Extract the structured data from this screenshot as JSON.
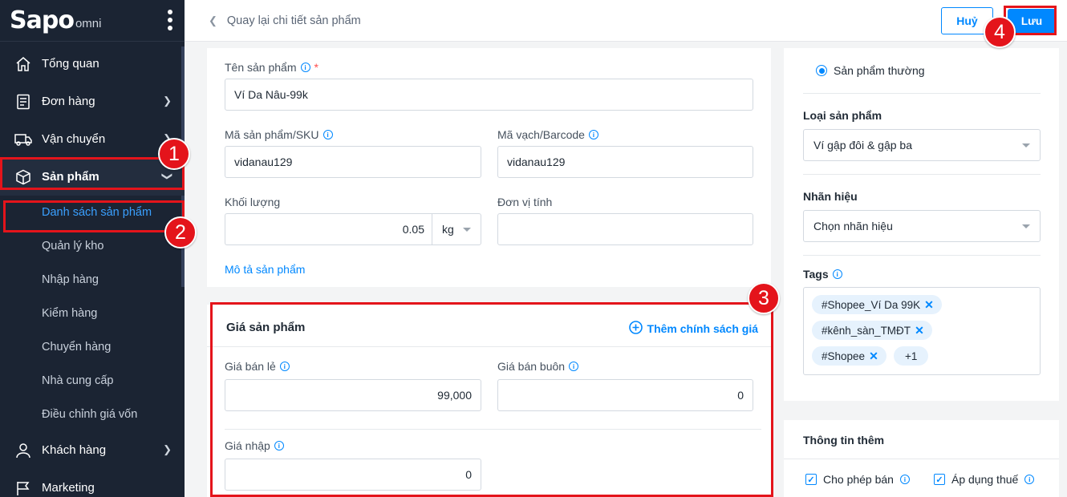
{
  "brand": {
    "logo": "Sapo",
    "suffix": "omni"
  },
  "sidebar": {
    "items": [
      {
        "label": "Tổng quan",
        "icon": "home-icon"
      },
      {
        "label": "Đơn hàng",
        "icon": "order-icon"
      },
      {
        "label": "Vận chuyển",
        "icon": "truck-icon"
      },
      {
        "label": "Sản phẩm",
        "icon": "box-icon"
      },
      {
        "label": "Khách hàng",
        "icon": "user-icon"
      },
      {
        "label": "Marketing",
        "icon": "flag-icon"
      }
    ],
    "sub_items": [
      {
        "label": "Danh sách sản phẩm"
      },
      {
        "label": "Quản lý kho"
      },
      {
        "label": "Nhập hàng"
      },
      {
        "label": "Kiểm hàng"
      },
      {
        "label": "Chuyển hàng"
      },
      {
        "label": "Nhà cung cấp"
      },
      {
        "label": "Điều chỉnh giá vốn"
      }
    ]
  },
  "header": {
    "back_label": "Quay lại chi tiết sản phẩm",
    "cancel_label": "Huỷ",
    "save_label": "Lưu"
  },
  "product": {
    "name_label": "Tên sản phẩm",
    "name_value": "Ví Da Nâu-99k",
    "sku_label": "Mã sản phẩm/SKU",
    "sku_value": "vidanau129",
    "barcode_label": "Mã vạch/Barcode",
    "barcode_value": "vidanau129",
    "weight_label": "Khối lượng",
    "weight_value": "0.05",
    "weight_unit": "kg",
    "unit_label": "Đơn vị tính",
    "unit_value": "",
    "description_link": "Mô tả sản phẩm"
  },
  "pricing": {
    "title": "Giá sản phẩm",
    "add_policy": "Thêm chính sách giá",
    "retail_label": "Giá bán lẻ",
    "retail_value": "99,000",
    "wholesale_label": "Giá bán buôn",
    "wholesale_value": "0",
    "cost_label": "Giá nhập",
    "cost_value": "0"
  },
  "side": {
    "product_type_option": "Sản phẩm thường",
    "category_label": "Loại sản phẩm",
    "category_value": "Ví gập đôi & gập ba",
    "brand_label": "Nhãn hiệu",
    "brand_value": "Chọn nhãn hiệu",
    "tags_label": "Tags",
    "tags": [
      "#Shopee_Ví Da 99K",
      "#kênh_sàn_TMĐT",
      "#Shopee"
    ],
    "tags_more": "+1",
    "extra_title": "Thông tin thêm",
    "allow_sale": "Cho phép bán",
    "apply_tax": "Áp dụng thuế"
  },
  "annotations": [
    "1",
    "2",
    "3",
    "4"
  ],
  "colors": {
    "accent": "#0088ff",
    "sidebar": "#1b2433",
    "annotation": "#e4141b"
  }
}
